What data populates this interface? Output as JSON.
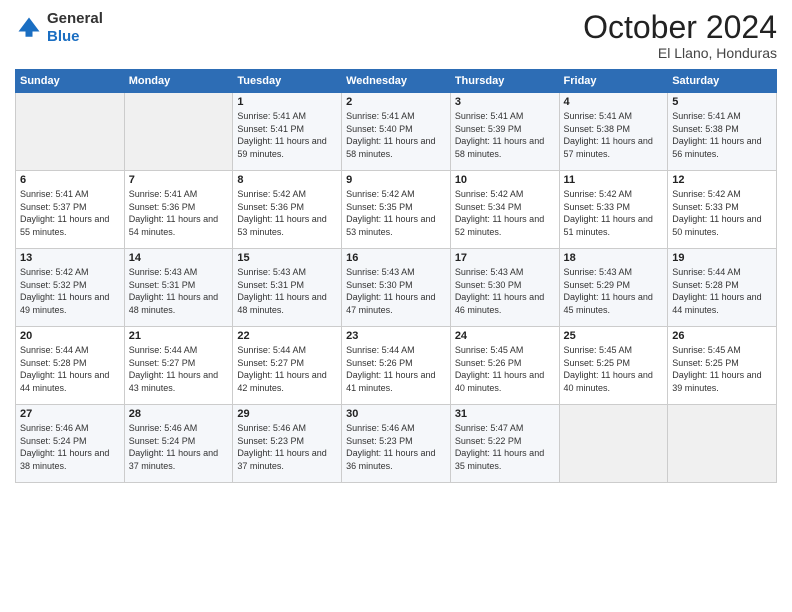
{
  "logo": {
    "line1": "General",
    "line2": "Blue"
  },
  "header": {
    "month": "October 2024",
    "location": "El Llano, Honduras"
  },
  "days_of_week": [
    "Sunday",
    "Monday",
    "Tuesday",
    "Wednesday",
    "Thursday",
    "Friday",
    "Saturday"
  ],
  "weeks": [
    [
      {
        "day": "",
        "info": ""
      },
      {
        "day": "",
        "info": ""
      },
      {
        "day": "1",
        "info": "Sunrise: 5:41 AM\nSunset: 5:41 PM\nDaylight: 11 hours and 59 minutes."
      },
      {
        "day": "2",
        "info": "Sunrise: 5:41 AM\nSunset: 5:40 PM\nDaylight: 11 hours and 58 minutes."
      },
      {
        "day": "3",
        "info": "Sunrise: 5:41 AM\nSunset: 5:39 PM\nDaylight: 11 hours and 58 minutes."
      },
      {
        "day": "4",
        "info": "Sunrise: 5:41 AM\nSunset: 5:38 PM\nDaylight: 11 hours and 57 minutes."
      },
      {
        "day": "5",
        "info": "Sunrise: 5:41 AM\nSunset: 5:38 PM\nDaylight: 11 hours and 56 minutes."
      }
    ],
    [
      {
        "day": "6",
        "info": "Sunrise: 5:41 AM\nSunset: 5:37 PM\nDaylight: 11 hours and 55 minutes."
      },
      {
        "day": "7",
        "info": "Sunrise: 5:41 AM\nSunset: 5:36 PM\nDaylight: 11 hours and 54 minutes."
      },
      {
        "day": "8",
        "info": "Sunrise: 5:42 AM\nSunset: 5:36 PM\nDaylight: 11 hours and 53 minutes."
      },
      {
        "day": "9",
        "info": "Sunrise: 5:42 AM\nSunset: 5:35 PM\nDaylight: 11 hours and 53 minutes."
      },
      {
        "day": "10",
        "info": "Sunrise: 5:42 AM\nSunset: 5:34 PM\nDaylight: 11 hours and 52 minutes."
      },
      {
        "day": "11",
        "info": "Sunrise: 5:42 AM\nSunset: 5:33 PM\nDaylight: 11 hours and 51 minutes."
      },
      {
        "day": "12",
        "info": "Sunrise: 5:42 AM\nSunset: 5:33 PM\nDaylight: 11 hours and 50 minutes."
      }
    ],
    [
      {
        "day": "13",
        "info": "Sunrise: 5:42 AM\nSunset: 5:32 PM\nDaylight: 11 hours and 49 minutes."
      },
      {
        "day": "14",
        "info": "Sunrise: 5:43 AM\nSunset: 5:31 PM\nDaylight: 11 hours and 48 minutes."
      },
      {
        "day": "15",
        "info": "Sunrise: 5:43 AM\nSunset: 5:31 PM\nDaylight: 11 hours and 48 minutes."
      },
      {
        "day": "16",
        "info": "Sunrise: 5:43 AM\nSunset: 5:30 PM\nDaylight: 11 hours and 47 minutes."
      },
      {
        "day": "17",
        "info": "Sunrise: 5:43 AM\nSunset: 5:30 PM\nDaylight: 11 hours and 46 minutes."
      },
      {
        "day": "18",
        "info": "Sunrise: 5:43 AM\nSunset: 5:29 PM\nDaylight: 11 hours and 45 minutes."
      },
      {
        "day": "19",
        "info": "Sunrise: 5:44 AM\nSunset: 5:28 PM\nDaylight: 11 hours and 44 minutes."
      }
    ],
    [
      {
        "day": "20",
        "info": "Sunrise: 5:44 AM\nSunset: 5:28 PM\nDaylight: 11 hours and 44 minutes."
      },
      {
        "day": "21",
        "info": "Sunrise: 5:44 AM\nSunset: 5:27 PM\nDaylight: 11 hours and 43 minutes."
      },
      {
        "day": "22",
        "info": "Sunrise: 5:44 AM\nSunset: 5:27 PM\nDaylight: 11 hours and 42 minutes."
      },
      {
        "day": "23",
        "info": "Sunrise: 5:44 AM\nSunset: 5:26 PM\nDaylight: 11 hours and 41 minutes."
      },
      {
        "day": "24",
        "info": "Sunrise: 5:45 AM\nSunset: 5:26 PM\nDaylight: 11 hours and 40 minutes."
      },
      {
        "day": "25",
        "info": "Sunrise: 5:45 AM\nSunset: 5:25 PM\nDaylight: 11 hours and 40 minutes."
      },
      {
        "day": "26",
        "info": "Sunrise: 5:45 AM\nSunset: 5:25 PM\nDaylight: 11 hours and 39 minutes."
      }
    ],
    [
      {
        "day": "27",
        "info": "Sunrise: 5:46 AM\nSunset: 5:24 PM\nDaylight: 11 hours and 38 minutes."
      },
      {
        "day": "28",
        "info": "Sunrise: 5:46 AM\nSunset: 5:24 PM\nDaylight: 11 hours and 37 minutes."
      },
      {
        "day": "29",
        "info": "Sunrise: 5:46 AM\nSunset: 5:23 PM\nDaylight: 11 hours and 37 minutes."
      },
      {
        "day": "30",
        "info": "Sunrise: 5:46 AM\nSunset: 5:23 PM\nDaylight: 11 hours and 36 minutes."
      },
      {
        "day": "31",
        "info": "Sunrise: 5:47 AM\nSunset: 5:22 PM\nDaylight: 11 hours and 35 minutes."
      },
      {
        "day": "",
        "info": ""
      },
      {
        "day": "",
        "info": ""
      }
    ]
  ]
}
